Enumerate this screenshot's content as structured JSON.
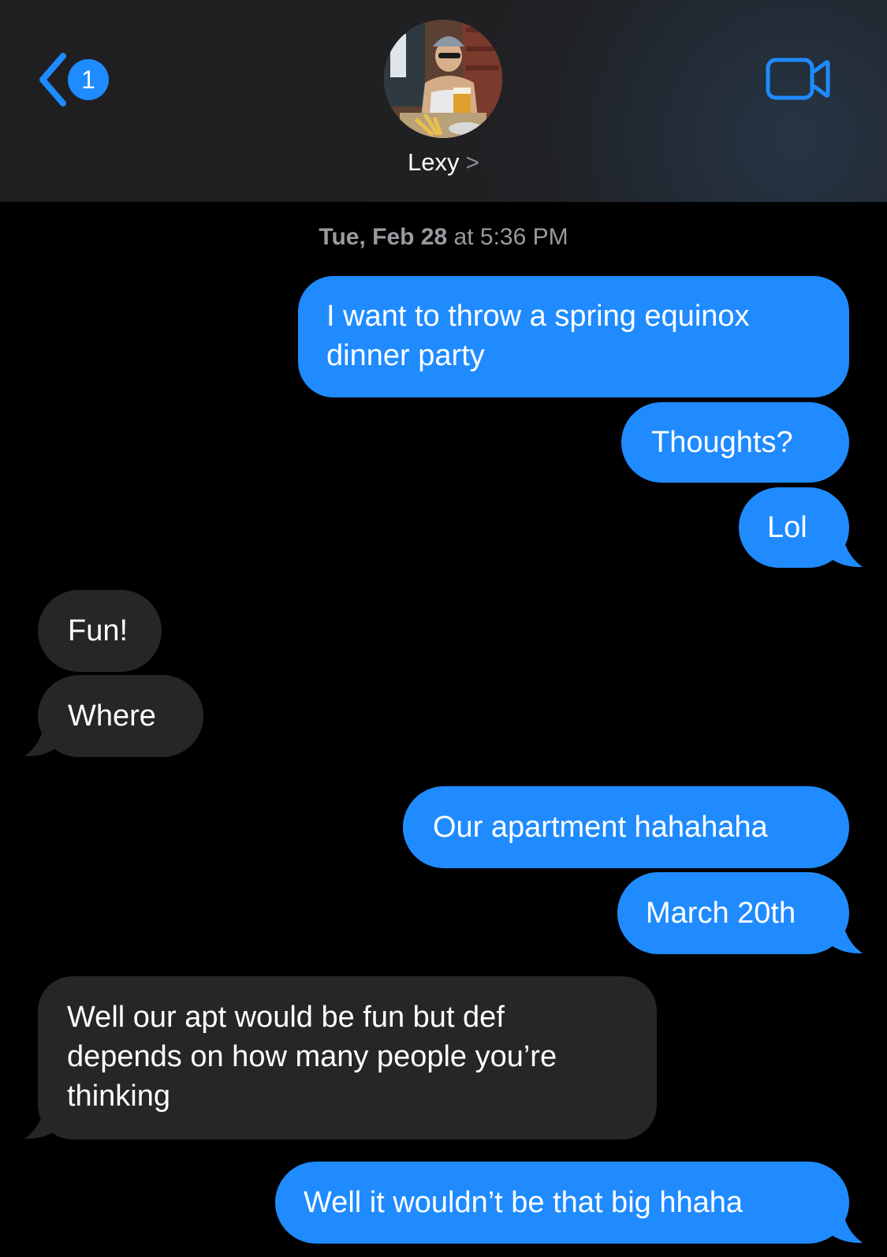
{
  "header": {
    "back_badge": "1",
    "contact_name": "Lexy",
    "contact_chevron": ">"
  },
  "conversation": {
    "timestamp_day": "Tue, Feb 28",
    "timestamp_at": "at",
    "timestamp_time": "5:36 PM",
    "messages": [
      {
        "direction": "sent",
        "lines": [
          "I want to throw a spring equinox",
          "dinner party"
        ]
      },
      {
        "direction": "sent",
        "lines": [
          "Thoughts?"
        ]
      },
      {
        "direction": "sent",
        "lines": [
          "Lol"
        ]
      },
      {
        "direction": "received",
        "lines": [
          "Fun!"
        ]
      },
      {
        "direction": "received",
        "lines": [
          "Where"
        ]
      },
      {
        "direction": "sent",
        "lines": [
          "Our apartment hahahaha"
        ]
      },
      {
        "direction": "sent",
        "lines": [
          "March 20th"
        ]
      },
      {
        "direction": "received",
        "lines": [
          "Well our apt would be fun but def",
          "depends on how many people you’re",
          "thinking"
        ]
      },
      {
        "direction": "sent",
        "lines": [
          "Well it wouldn’t be that big hhaha"
        ]
      }
    ]
  },
  "colors": {
    "sent_bubble": "#1f8bff",
    "received_bubble": "#262628",
    "accent": "#1e8bff",
    "background": "#000000"
  },
  "icons": {
    "back": "chevron-left-icon",
    "video": "video-camera-icon"
  }
}
